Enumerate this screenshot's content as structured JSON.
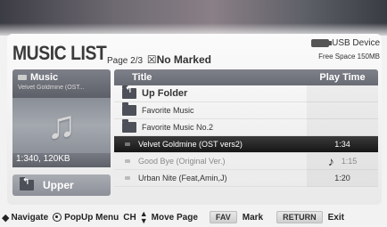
{
  "header": {
    "title": "MUSIC LIST",
    "page": "Page 2/3",
    "marked_icon": "☒",
    "marked": "No Marked",
    "device": "USB Device",
    "free_space": "Free Space 150MB"
  },
  "sidebar": {
    "category": "Music",
    "now_title": "Velvet Goldmine (OST...",
    "info": "1:340, 120KB",
    "upper": "Upper"
  },
  "table": {
    "col_title": "Title",
    "col_time": "Play Time",
    "rows": [
      {
        "title": "Up Folder",
        "time": ""
      },
      {
        "title": "Favorite Music",
        "time": ""
      },
      {
        "title": "Favorite Music No.2",
        "time": ""
      },
      {
        "title": "Velvet Goldmine (OST vers2)",
        "time": "1:34"
      },
      {
        "title": "Good Bye (Original Ver.)",
        "time": "1:15"
      },
      {
        "title": "Urban Nite (Feat,Amin,J)",
        "time": "1:20"
      }
    ]
  },
  "help": {
    "navigate": "Navigate",
    "popup": "PopUp Menu",
    "ch": "CH",
    "move_page": "Move Page",
    "fav_key": "FAV",
    "mark": "Mark",
    "return_key": "RETURN",
    "exit": "Exit"
  },
  "icons": [
    "music-note-icon",
    "usb-icon",
    "folder-icon",
    "up-folder-icon",
    "file-icon",
    "playing-note-icon",
    "nav-arrows-icon",
    "ok-icon",
    "ch-updown-icon"
  ],
  "colors": {
    "selected_row": "#1a1a1a",
    "header_gray": "#6e7179"
  }
}
